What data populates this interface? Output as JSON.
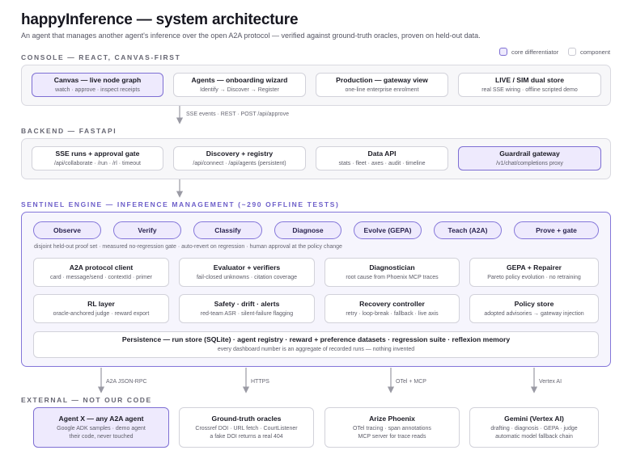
{
  "header": {
    "title": "happyInference — system architecture",
    "subtitle": "An agent that manages another agent's inference over the open A2A protocol — verified against ground-truth oracles, proven on held-out data."
  },
  "legend": {
    "core": "core differentiator",
    "component": "component"
  },
  "colors": {
    "accent": "#7e6fd3",
    "core_fill": "#eeeafd",
    "panel_fill": "#f7f7f9",
    "arrow": "#9a9aa4"
  },
  "console": {
    "label": "CONSOLE — REACT, CANVAS-FIRST",
    "boxes": [
      {
        "title": "Canvas — live node graph",
        "sub": "watch · approve · inspect receipts",
        "core": true
      },
      {
        "title": "Agents — onboarding wizard",
        "sub": "Identify → Discover → Register",
        "core": false
      },
      {
        "title": "Production — gateway view",
        "sub": "one-line enterprise enrolment",
        "core": false
      },
      {
        "title": "LIVE / SIM dual store",
        "sub": "real SSE wiring · offline scripted demo",
        "core": false
      }
    ],
    "link_label": "SSE events · REST · POST /api/approve"
  },
  "backend": {
    "label": "BACKEND — FASTAPI",
    "boxes": [
      {
        "title": "SSE runs + approval gate",
        "sub": "/api/collaborate · /run · /rl · timeout",
        "core": false
      },
      {
        "title": "Discovery + registry",
        "sub": "/api/connect · /api/agents (persistent)",
        "core": false
      },
      {
        "title": "Data API",
        "sub": "stats · fleet · axes · audit · timeline",
        "core": false
      },
      {
        "title": "Guardrail gateway",
        "sub": "/v1/chat/completions proxy",
        "core": true
      }
    ]
  },
  "sentinel": {
    "label": "SENTINEL ENGINE — INFERENCE MANAGEMENT (~290 OFFLINE TESTS)",
    "pipeline": [
      "Observe",
      "Verify",
      "Classify",
      "Diagnose",
      "Evolve (GEPA)",
      "Teach (A2A)",
      "Prove + gate"
    ],
    "pipeline_note": "disjoint held-out proof set · measured no-regression gate · auto-revert on regression · human approval at the policy change",
    "row1": [
      {
        "title": "A2A protocol client",
        "sub": "card · message/send · contextId · primer"
      },
      {
        "title": "Evaluator + verifiers",
        "sub": "fail-closed unknowns · citation coverage"
      },
      {
        "title": "Diagnostician",
        "sub": "root cause from Phoenix MCP traces"
      },
      {
        "title": "GEPA + Repairer",
        "sub": "Pareto policy evolution · no retraining"
      }
    ],
    "row2": [
      {
        "title": "RL layer",
        "sub": "oracle-anchored judge · reward export"
      },
      {
        "title": "Safety · drift · alerts",
        "sub": "red-team ASR · silent-failure flagging"
      },
      {
        "title": "Recovery controller",
        "sub": "retry · loop-break · fallback · live axis"
      },
      {
        "title": "Policy store",
        "sub": "adopted advisories → gateway injection"
      }
    ],
    "persistence": {
      "title": "Persistence — run store (SQLite) · agent registry · reward + preference datasets · regression suite · reflexion memory",
      "sub": "every dashboard number is an aggregate of recorded runs — nothing invented"
    }
  },
  "external": {
    "label": "EXTERNAL — NOT OUR CODE",
    "connectors": [
      "A2A JSON-RPC",
      "HTTPS",
      "OTel + MCP",
      "Vertex AI"
    ],
    "boxes": [
      {
        "title": "Agent X — any A2A agent",
        "sub1": "Google ADK samples · demo agent",
        "sub2": "their code, never touched",
        "core": true
      },
      {
        "title": "Ground-truth oracles",
        "sub1": "Crossref DOI · URL fetch · CourtListener",
        "sub2": "a fake DOI returns a real 404",
        "core": false
      },
      {
        "title": "Arize Phoenix",
        "sub1": "OTel tracing · span annotations",
        "sub2": "MCP server for trace reads",
        "core": false
      },
      {
        "title": "Gemini (Vertex AI)",
        "sub1": "drafting · diagnosis · GEPA · judge",
        "sub2": "automatic model fallback chain",
        "core": false
      }
    ]
  }
}
